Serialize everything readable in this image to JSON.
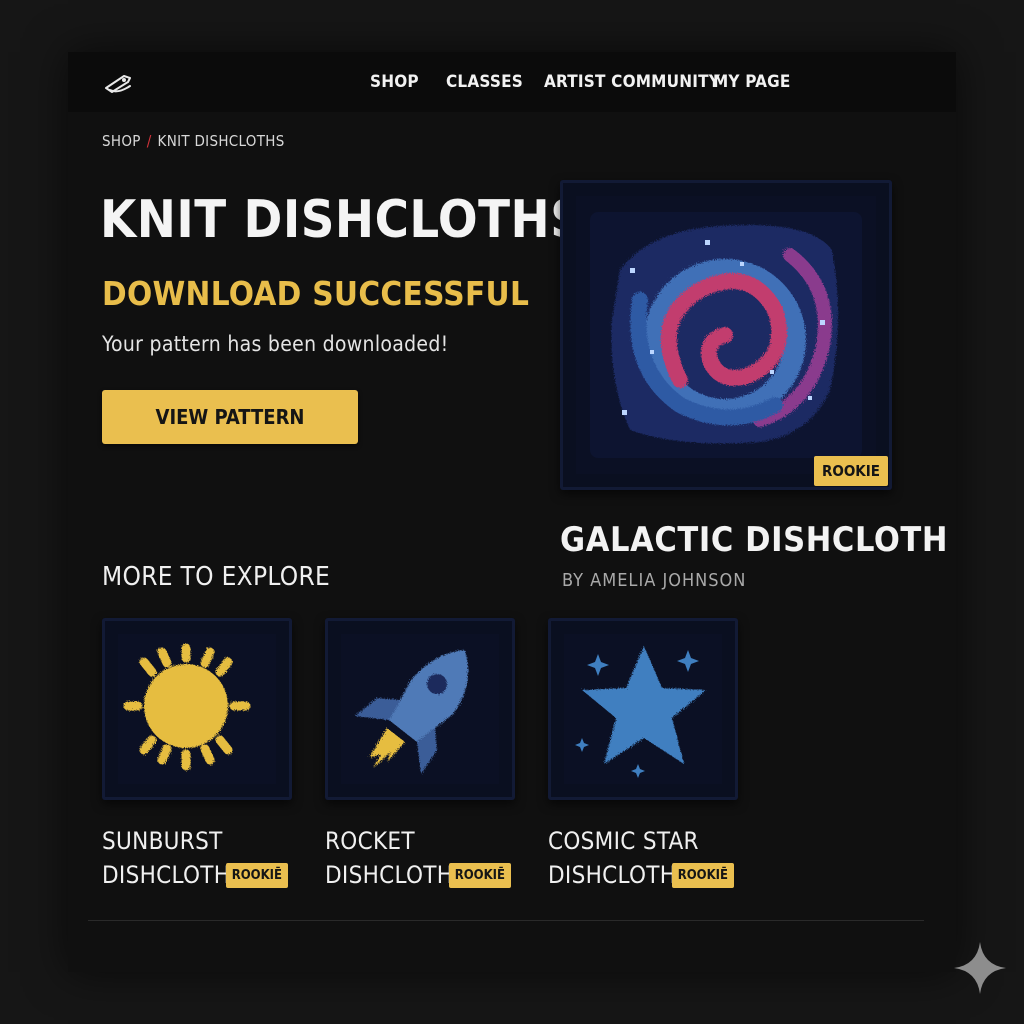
{
  "nav": {
    "items": [
      {
        "label": "SHOP"
      },
      {
        "label": "CLASSES"
      },
      {
        "label": "ARTIST COMMUNITY"
      },
      {
        "label": "MY PAGE"
      }
    ]
  },
  "breadcrumb": {
    "items": [
      "SHOP",
      "KNIT DISHCLOTHS"
    ],
    "separator": "/"
  },
  "page": {
    "title": "KNIT DISHCLOTHS",
    "status_title": "DOWNLOAD SUCCESSFUL",
    "status_message": "Your pattern has been downloaded!",
    "view_button_label": "VIEW PATTERN"
  },
  "featured": {
    "title": "GALACTIC DISHCLOTH",
    "author": "BY AMELIA JOHNSON",
    "badge": "ROOKIE",
    "image": "galaxy-spiral-knit"
  },
  "explore": {
    "heading": "MORE TO EXPLORE",
    "items": [
      {
        "title_line1": "SUNBURST",
        "title_line2": "DISHCLOTH",
        "badge": "ROOKIĒ",
        "image": "sun-knit"
      },
      {
        "title_line1": "ROCKET",
        "title_line2": "DISHCLOTH",
        "badge": "ROOKIĒ",
        "image": "rocket-knit"
      },
      {
        "title_line1": "COSMIC STAR",
        "title_line2": "DISHCLOTH",
        "badge": "ROOKIĒ",
        "image": "star-knit"
      }
    ]
  },
  "colors": {
    "background": "#161616",
    "panel": "#101010",
    "accent": "#eabf4f",
    "breadcrumb_separator": "#d3343b",
    "muted_text": "#a9a9a9"
  }
}
